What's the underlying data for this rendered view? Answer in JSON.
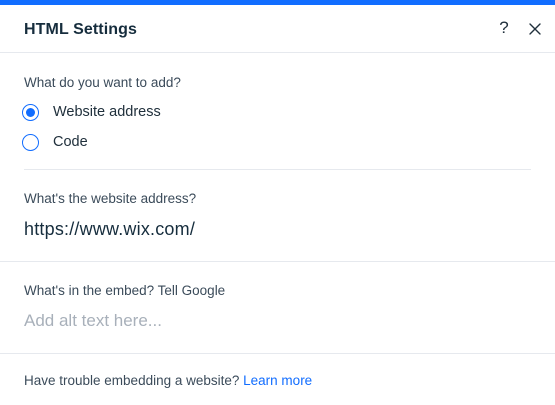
{
  "panel": {
    "title": "HTML Settings",
    "help_label": "?",
    "accent_color": "#116dff"
  },
  "add_type": {
    "question": "What do you want to add?",
    "options": [
      {
        "label": "Website address",
        "selected": true
      },
      {
        "label": "Code",
        "selected": false
      }
    ]
  },
  "website": {
    "question": "What's the website address?",
    "value": "https://www.wix.com/"
  },
  "alt_text": {
    "question": "What's in the embed? Tell Google",
    "value": "",
    "placeholder": "Add alt text here..."
  },
  "footer": {
    "text": "Have trouble embedding a website?",
    "link_label": "Learn more"
  },
  "icons": {
    "help": "help-icon",
    "close": "close-icon"
  }
}
